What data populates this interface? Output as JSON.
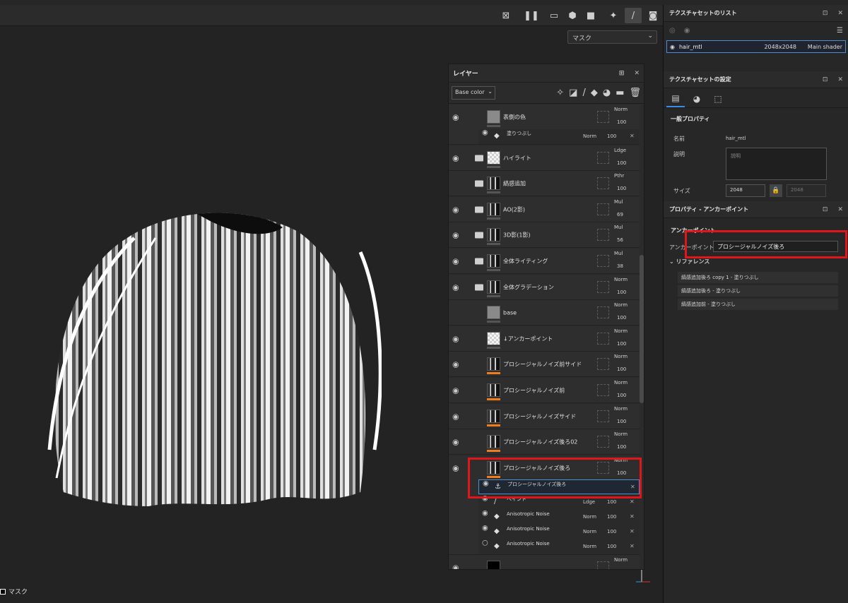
{
  "viewport": {
    "mask_dropdown": "マスク",
    "footer_label": "マスク"
  },
  "layers_panel": {
    "title": "レイヤー",
    "channel": "Base color",
    "rows": [
      {
        "name": "表側の色",
        "blend": "Norm",
        "opacity": "100"
      },
      {
        "name": "ハイライト",
        "blend": "Ldge",
        "opacity": "100"
      },
      {
        "name": "縞感追加",
        "blend": "Pthr",
        "opacity": "100"
      },
      {
        "name": "AO(2影)",
        "blend": "Mul",
        "opacity": "69"
      },
      {
        "name": "3D影(1影)",
        "blend": "Mul",
        "opacity": "56"
      },
      {
        "name": "全体ライティング",
        "blend": "Mul",
        "opacity": "38"
      },
      {
        "name": "全体グラデーション",
        "blend": "Norm",
        "opacity": "100"
      },
      {
        "name": "base",
        "blend": "Norm",
        "opacity": "100"
      },
      {
        "name": "↓アンカーポイント",
        "blend": "Norm",
        "opacity": "100"
      },
      {
        "name": "プロシージャルノイズ前サイド",
        "blend": "Norm",
        "opacity": "100"
      },
      {
        "name": "プロシージャルノイズ前",
        "blend": "Norm",
        "opacity": "100"
      },
      {
        "name": "プロシージャルノイズサイド",
        "blend": "Norm",
        "opacity": "100"
      },
      {
        "name": "プロシージャルノイズ後ろ02",
        "blend": "Norm",
        "opacity": "100"
      },
      {
        "name": "プロシージャルノイズ後ろ",
        "blend": "Norm",
        "opacity": "100"
      },
      {
        "name": "",
        "blend": "Norm",
        "opacity": "100"
      }
    ],
    "sub_fill": {
      "name": "塗りつぶし",
      "blend": "Norm",
      "opacity": "100"
    },
    "sub_anchor": {
      "name": "プロシージャルノイズ後ろ"
    },
    "sub_effects": [
      {
        "name": "ペイント",
        "blend": "Ldge",
        "opacity": "100"
      },
      {
        "name": "Anisotropic Noise",
        "blend": "Norm",
        "opacity": "100"
      },
      {
        "name": "Anisotropic Noise",
        "blend": "Norm",
        "opacity": "100"
      },
      {
        "name": "Anisotropic Noise",
        "blend": "Norm",
        "opacity": "100"
      }
    ]
  },
  "texture_set_list": {
    "title": "テクスチャセットのリスト",
    "item_name": "hair_mtl",
    "item_size": "2048x2048",
    "item_shader": "Main shader"
  },
  "texture_set_settings": {
    "title": "テクスチャセットの設定",
    "section": "一般プロパティ",
    "name_label": "名前",
    "name_value": "hair_mtl",
    "desc_label": "説明",
    "desc_placeholder": "説明",
    "size_label": "サイズ",
    "size_value": "2048",
    "size_value2": "2048"
  },
  "anchor_panel": {
    "title": "プロパティ - アンカーポイント",
    "section": "アンカーポイント",
    "name_label": "アンカーポイント名",
    "name_value": "プロシージャルノイズ後ろ",
    "ref_title": "リファレンス",
    "refs": [
      "縞感追加後ろ copy 1 - 塗りつぶし",
      "縞感追加後ろ - 塗りつぶし",
      "縞感追加前 - 塗りつぶし"
    ]
  }
}
